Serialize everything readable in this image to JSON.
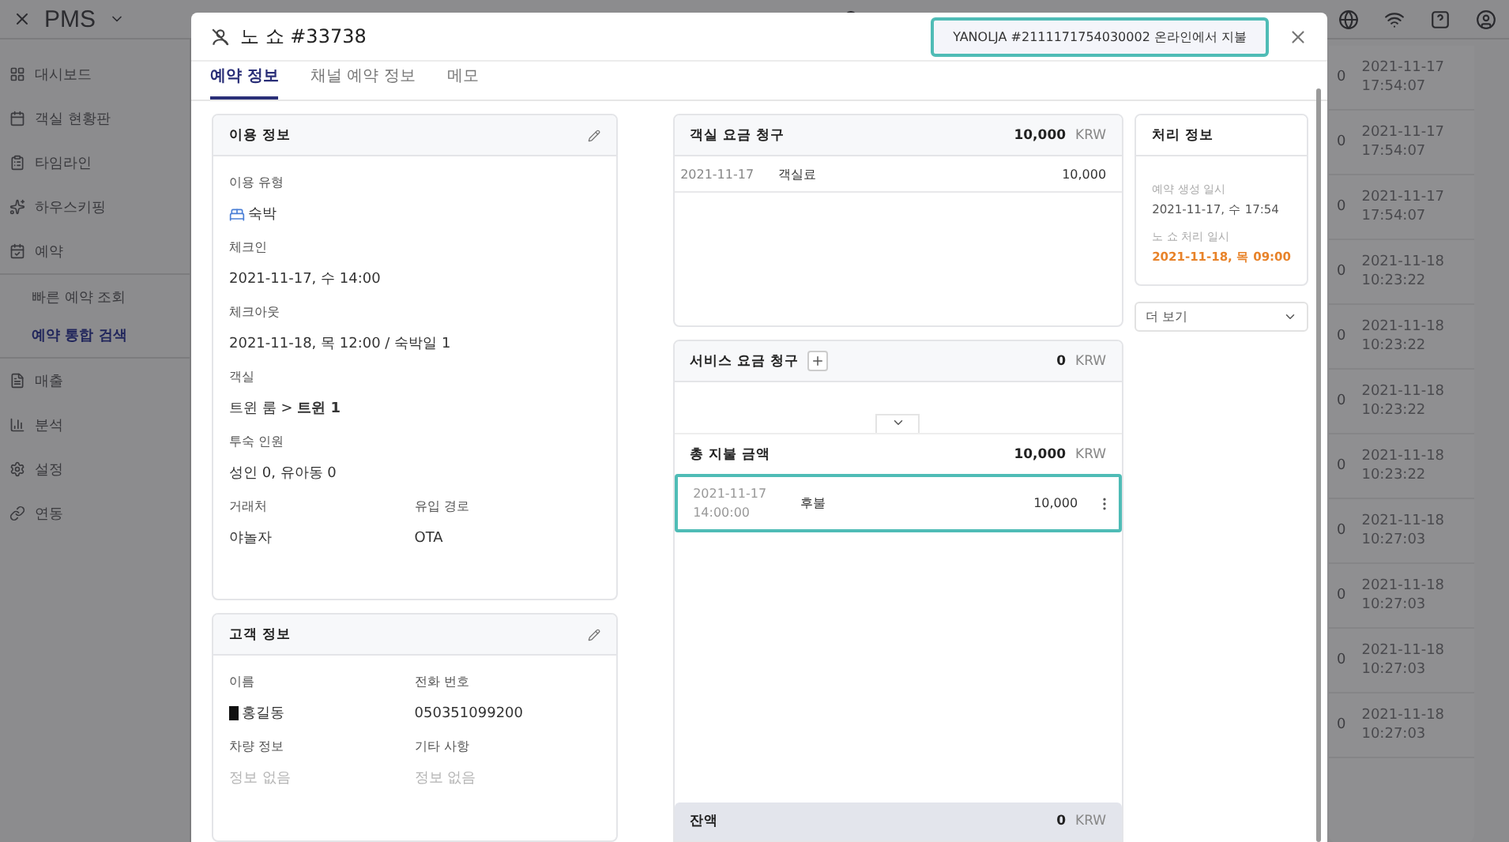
{
  "app": {
    "logo": "PMS"
  },
  "sidebar": {
    "items": [
      {
        "label": "대시보드",
        "selected": false
      },
      {
        "label": "객실 현황판",
        "selected": false
      },
      {
        "label": "타임라인",
        "selected": false
      },
      {
        "label": "하우스키핑",
        "selected": false
      },
      {
        "label": "예약",
        "selected": false,
        "children": [
          {
            "label": "빠른 예약 조회",
            "selected": false
          },
          {
            "label": "예약 통합 검색",
            "selected": true
          }
        ]
      },
      {
        "label": "매출",
        "selected": false
      },
      {
        "label": "분석",
        "selected": false
      },
      {
        "label": "설정",
        "selected": false
      },
      {
        "label": "연동",
        "selected": false
      }
    ]
  },
  "background_list": [
    {
      "count": "0",
      "date": "2021-11-17",
      "time": "17:54:07"
    },
    {
      "count": "0",
      "date": "2021-11-17",
      "time": "17:54:07"
    },
    {
      "count": "0",
      "date": "2021-11-17",
      "time": "17:54:07"
    },
    {
      "count": "0",
      "date": "2021-11-18",
      "time": "10:23:22"
    },
    {
      "count": "0",
      "date": "2021-11-18",
      "time": "10:23:22"
    },
    {
      "count": "0",
      "date": "2021-11-18",
      "time": "10:23:22"
    },
    {
      "count": "0",
      "date": "2021-11-18",
      "time": "10:23:22"
    },
    {
      "count": "0",
      "date": "2021-11-18",
      "time": "10:27:03"
    },
    {
      "count": "0",
      "date": "2021-11-18",
      "time": "10:27:03"
    },
    {
      "count": "0",
      "date": "2021-11-18",
      "time": "10:27:03"
    },
    {
      "count": "0",
      "date": "2021-11-18",
      "time": "10:27:03"
    }
  ],
  "modal": {
    "title": "노 쇼 #33738",
    "channel_badge": {
      "text": "YANOLJA #2111171754030002 온라인에서 지불",
      "highlighted": true
    },
    "tabs": [
      {
        "label": "예약 정보",
        "selected": true
      },
      {
        "label": "채널 예약 정보",
        "selected": false
      },
      {
        "label": "메모",
        "selected": false
      }
    ],
    "usage_info": {
      "title": "이용 정보",
      "rows": [
        [
          {
            "label": "이용 유형",
            "value": "숙박",
            "kind": "stay"
          }
        ],
        [
          {
            "label": "체크인",
            "value": "2021-11-17, 수 14:00",
            "kind": "text"
          }
        ],
        [
          {
            "label": "체크아웃",
            "value": "2021-11-18, 목 12:00 / 숙박일 1",
            "kind": "text"
          }
        ],
        [
          {
            "label": "객실",
            "value": "트윈 룸 > **트윈 1**",
            "kind": "text"
          }
        ],
        [
          {
            "label": "투숙 인원",
            "value": "성인 0, 유아동 0",
            "kind": "text"
          }
        ],
        [
          {
            "label": "거래처",
            "value": "야놀자",
            "kind": "text"
          },
          {
            "label": "유입 경로",
            "value": "OTA",
            "kind": "text"
          }
        ]
      ]
    },
    "guest_info": {
      "title": "고객 정보",
      "rows": [
        [
          {
            "label": "이름",
            "value": "홍길동",
            "kind": "masked"
          },
          {
            "label": "전화 번호",
            "value": "050351099200",
            "kind": "text"
          }
        ],
        [
          {
            "label": "차량 정보",
            "value": "정보 없음",
            "kind": "empty"
          },
          {
            "label": "기타 사항",
            "value": "정보 없음",
            "kind": "empty"
          }
        ]
      ]
    },
    "room_charges": {
      "title": "객실 요금 청구",
      "total": "10,000",
      "currency": "KRW",
      "rows": [
        {
          "date": "2021-11-17",
          "item": "객실료",
          "amount": "10,000"
        }
      ]
    },
    "service_charges": {
      "title": "서비스 요금 청구",
      "total": "0",
      "currency": "KRW"
    },
    "payments": {
      "title": "총 지불 금액",
      "total": "10,000",
      "currency": "KRW",
      "rows": [
        {
          "date": "2021-11-17",
          "time": "14:00:00",
          "method": "후불",
          "amount": "10,000",
          "highlighted": true
        }
      ]
    },
    "balance": {
      "title": "잔액",
      "total": "0",
      "currency": "KRW"
    },
    "processing": {
      "title": "처리 정보",
      "items": [
        {
          "label": "예약 생성 일시",
          "value": "2021-11-17, 수 17:54",
          "kind": "normal"
        },
        {
          "label": "노 쇼 처리 일시",
          "value": "2021-11-18, 목 09:00",
          "kind": "alert"
        }
      ]
    },
    "more_dropdown": {
      "label": "더 보기"
    }
  }
}
